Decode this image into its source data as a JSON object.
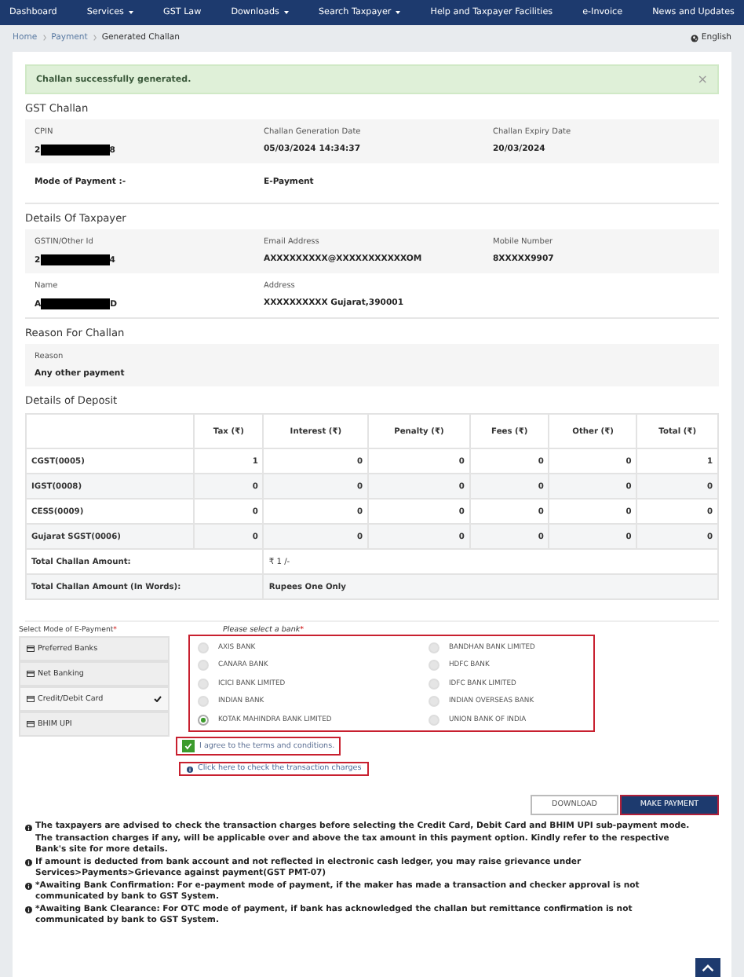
{
  "nav": [
    {
      "label": "Dashboard",
      "dropdown": false
    },
    {
      "label": "Services",
      "dropdown": true
    },
    {
      "label": "GST Law",
      "dropdown": false
    },
    {
      "label": "Downloads",
      "dropdown": true
    },
    {
      "label": "Search Taxpayer",
      "dropdown": true
    },
    {
      "label": "Help and Taxpayer Facilities",
      "dropdown": false
    },
    {
      "label": "e-Invoice",
      "dropdown": false
    },
    {
      "label": "News and Updates",
      "dropdown": false
    }
  ],
  "breadcrumb": [
    {
      "label": "Home",
      "link": true
    },
    {
      "label": "Payment",
      "link": true
    },
    {
      "label": "Generated Challan",
      "link": false
    }
  ],
  "language": "English",
  "alert": {
    "message": "Challan successfully generated.",
    "close": "×"
  },
  "gst_challan": {
    "title": "GST Challan",
    "fields": [
      {
        "label": "CPIN",
        "prefix": "2",
        "suffix": "8",
        "redacted": true
      },
      {
        "label": "Challan Generation Date",
        "value": "05/03/2024 14:34:37",
        "redacted": false
      },
      {
        "label": "Challan Expiry Date",
        "value": "20/03/2024",
        "redacted": false
      }
    ],
    "mode_label": "Mode of Payment :-",
    "mode_value": "E-Payment"
  },
  "taxpayer": {
    "title": "Details Of Taxpayer",
    "rows": [
      [
        {
          "label": "GSTIN/Other Id",
          "prefix": "2",
          "suffix": "4",
          "redacted": true
        },
        {
          "label": "Email Address",
          "value": "AXXXXXXXXX@XXXXXXXXXXXOM",
          "redacted": false
        },
        {
          "label": "Mobile Number",
          "value": "8XXXXX9907",
          "redacted": false
        }
      ],
      [
        {
          "label": "Name",
          "prefix": "A",
          "suffix": "D",
          "redacted": true
        },
        {
          "label": "Address",
          "value": "XXXXXXXXXX Gujarat,390001",
          "redacted": false
        }
      ]
    ]
  },
  "reason": {
    "title": "Reason For Challan",
    "label": "Reason",
    "value": "Any other payment"
  },
  "deposit": {
    "title": "Details of Deposit",
    "columns": [
      "Tax (₹)",
      "Interest (₹)",
      "Penalty (₹)",
      "Fees (₹)",
      "Other (₹)",
      "Total (₹)"
    ],
    "rows": [
      {
        "head": "CGST(0005)",
        "cells": [
          "1",
          "0",
          "0",
          "0",
          "0",
          "1"
        ]
      },
      {
        "head": "IGST(0008)",
        "cells": [
          "0",
          "0",
          "0",
          "0",
          "0",
          "0"
        ]
      },
      {
        "head": "CESS(0009)",
        "cells": [
          "0",
          "0",
          "0",
          "0",
          "0",
          "0"
        ]
      },
      {
        "head": "Gujarat SGST(0006)",
        "cells": [
          "0",
          "0",
          "0",
          "0",
          "0",
          "0"
        ]
      }
    ],
    "total_label": "Total Challan Amount:",
    "total_value": "₹ 1 /-",
    "words_label": "Total Challan Amount (In Words):",
    "words_value": "Rupees One Only"
  },
  "epayment": {
    "mode_title": "Select Mode of E-Payment",
    "required": "*",
    "modes": [
      {
        "label": "Preferred Banks",
        "selected": false
      },
      {
        "label": "Net Banking",
        "selected": false
      },
      {
        "label": "Credit/Debit Card",
        "selected": true
      },
      {
        "label": "BHIM UPI",
        "selected": false
      }
    ],
    "bank_title": "Please select a bank",
    "banks": [
      {
        "name": "AXIS BANK",
        "selected": false
      },
      {
        "name": "BANDHAN BANK LIMITED",
        "selected": false
      },
      {
        "name": "CANARA BANK",
        "selected": false
      },
      {
        "name": "HDFC BANK",
        "selected": false
      },
      {
        "name": "ICICI BANK LIMITED",
        "selected": false
      },
      {
        "name": "IDFC BANK LIMITED",
        "selected": false
      },
      {
        "name": "INDIAN BANK",
        "selected": false
      },
      {
        "name": "INDIAN OVERSEAS BANK",
        "selected": false
      },
      {
        "name": "KOTAK MAHINDRA BANK LIMITED",
        "selected": true
      },
      {
        "name": "UNION BANK OF INDIA",
        "selected": false
      }
    ],
    "terms": {
      "label": "I agree to the terms and conditions.",
      "checked": true
    },
    "charges_link": "Click here to check the transaction charges"
  },
  "buttons": {
    "download": "DOWNLOAD",
    "pay": "MAKE PAYMENT"
  },
  "notes": [
    "The taxpayers are advised to check the transaction charges before selecting the Credit Card, Debit Card and BHIM UPI sub-payment mode. The transaction charges if any, will be applicable over and above the tax amount in this payment option. Kindly refer to the respective Bank's site for more details.",
    "If amount is deducted from bank account and not reflected in electronic cash ledger, you may raise grievance under Services>Payments>Grievance against payment(GST PMT-07)",
    "*Awaiting Bank Confirmation: For e-payment mode of payment, if the maker has made a transaction and checker approval is not communicated by bank to GST System.",
    "*Awaiting Bank Clearance: For OTC mode of payment, if bank has acknowledged the challan but remittance confirmation is not communicated by bank to GST System."
  ]
}
